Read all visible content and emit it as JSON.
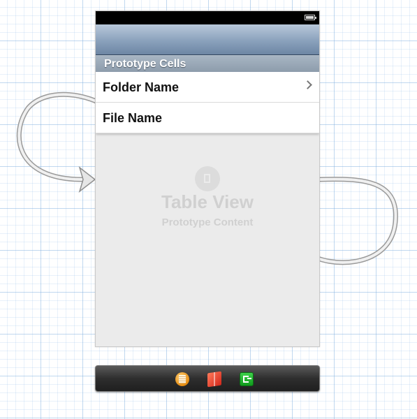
{
  "scene": {
    "section_header": "Prototype Cells",
    "cells": [
      {
        "label": "Folder Name",
        "accessory": "chevron-right-icon"
      },
      {
        "label": "File Name"
      }
    ],
    "placeholder": {
      "icon": "table-view-icon",
      "title": "Table View",
      "subtitle": "Prototype Content"
    }
  },
  "dock": {
    "icons": [
      "first-responder-icon",
      "view-controller-object-icon",
      "exit-icon"
    ]
  },
  "colors": {
    "nav_bar": "#8aa1bc",
    "section_header": "#98a6b5",
    "scene_background": "#ebebeb",
    "dock": "#2e2e2e",
    "segue_line": "#d4d4d4"
  }
}
